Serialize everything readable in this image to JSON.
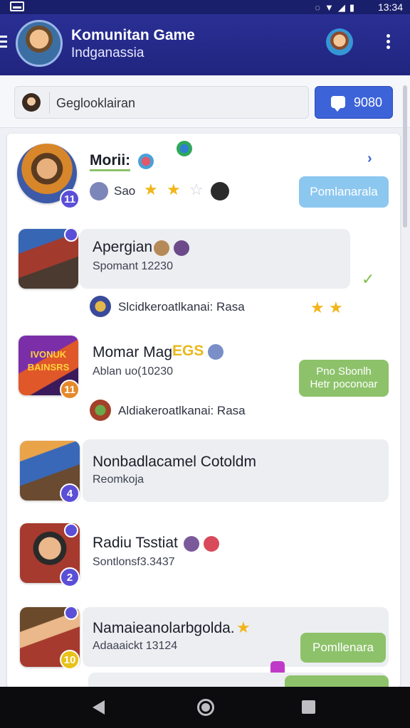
{
  "status_bar": {
    "time": "13:34"
  },
  "app_bar": {
    "title": "Komunitan Game",
    "subtitle": "Indganassia"
  },
  "search": {
    "placeholder": "Geglooklairan",
    "button_label": "9080"
  },
  "feed": [
    {
      "name": "Morii:",
      "meta": "Sao",
      "badge": "11",
      "chip": "Pomlanarala"
    },
    {
      "name": "Apergian",
      "sub": "Spomant 12230",
      "badge": "",
      "reply": "Slcidkeroatlkanai: Rasa"
    },
    {
      "name": "Momar Mag",
      "name_tag": "EGS",
      "sub": "Ablan uo(10230",
      "badge": "11",
      "chip_lines": [
        "Pno Sbonlh",
        "Hetr poconoar"
      ],
      "reply": "Aldiakeroatlkanai: Rasa",
      "art_text": [
        "IVONUK",
        "BAINSRS"
      ]
    },
    {
      "name": "Nonbadlacamel Cotoldm",
      "sub": "Reomkoja",
      "badge": "4"
    },
    {
      "name": "Radiu Tsstiat",
      "sub": "Sontlonsf3.3437",
      "badge": "2"
    },
    {
      "name": "Namaieanolarbgolda.",
      "sub": "Adaaaickt 13124",
      "badge": "10",
      "chip": "Pomllenara"
    }
  ],
  "colors": {
    "app_bar": "#2a2f95",
    "accent": "#3d63d8",
    "chip_blue": "#8cc7f0",
    "chip_green": "#8dc26a"
  }
}
